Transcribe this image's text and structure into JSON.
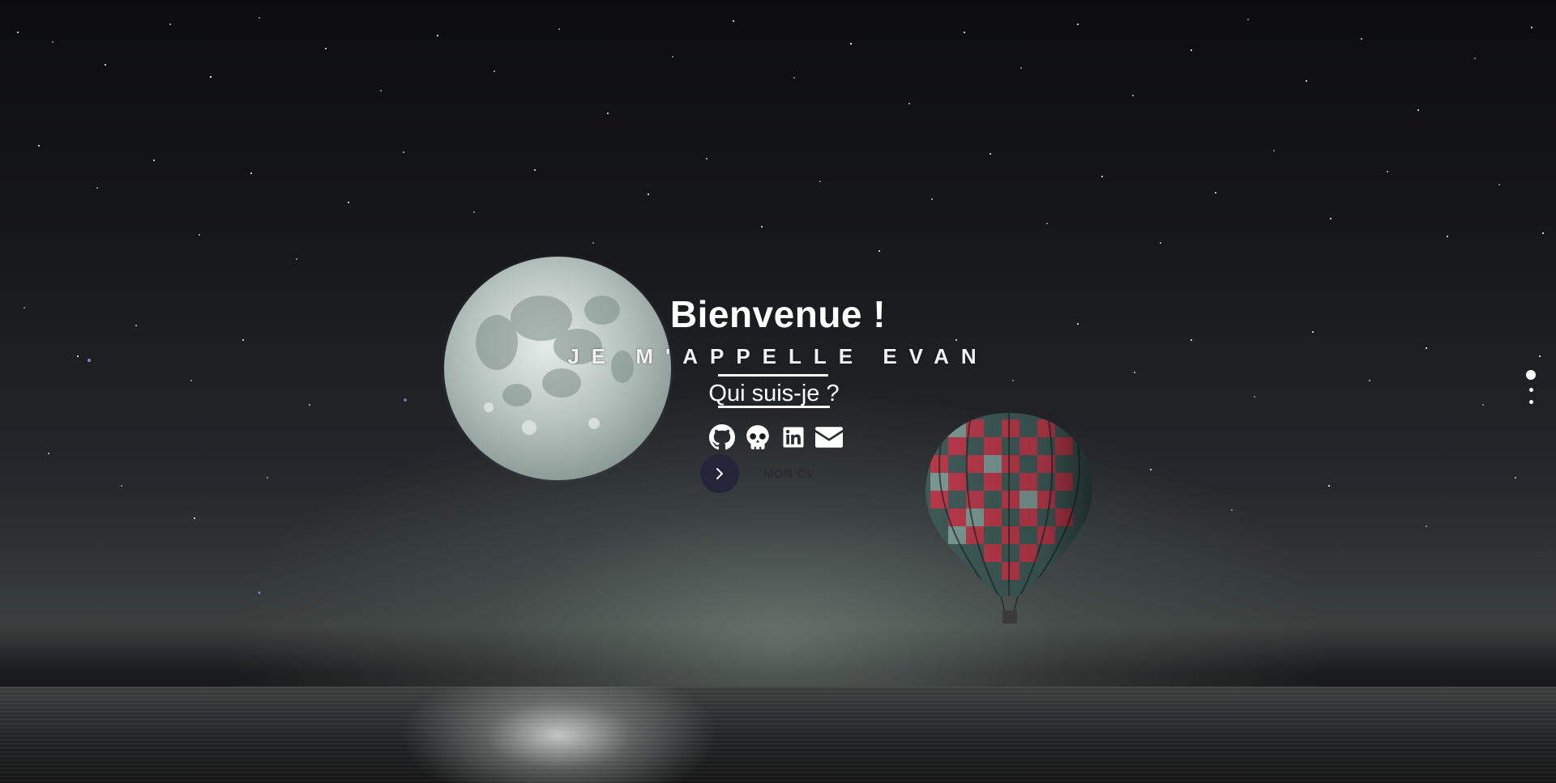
{
  "hero": {
    "title": "Bienvenue !",
    "subtitle": "JE M'APPELLE EVAN",
    "who_link": "Qui suis-je ?",
    "socials": [
      {
        "icon": "github-icon"
      },
      {
        "icon": "skull-icon"
      },
      {
        "icon": "linkedin-icon"
      },
      {
        "icon": "envelope-icon"
      }
    ],
    "cv_button_icon": "chevron-right-icon",
    "cv_label": "MON CV"
  },
  "section_nav": {
    "dots": 3,
    "active_index": 0
  },
  "colors": {
    "text": "#ffffff",
    "cv_button_bg": "#242538",
    "cv_label": "#2a2b33",
    "background": "#111214"
  }
}
